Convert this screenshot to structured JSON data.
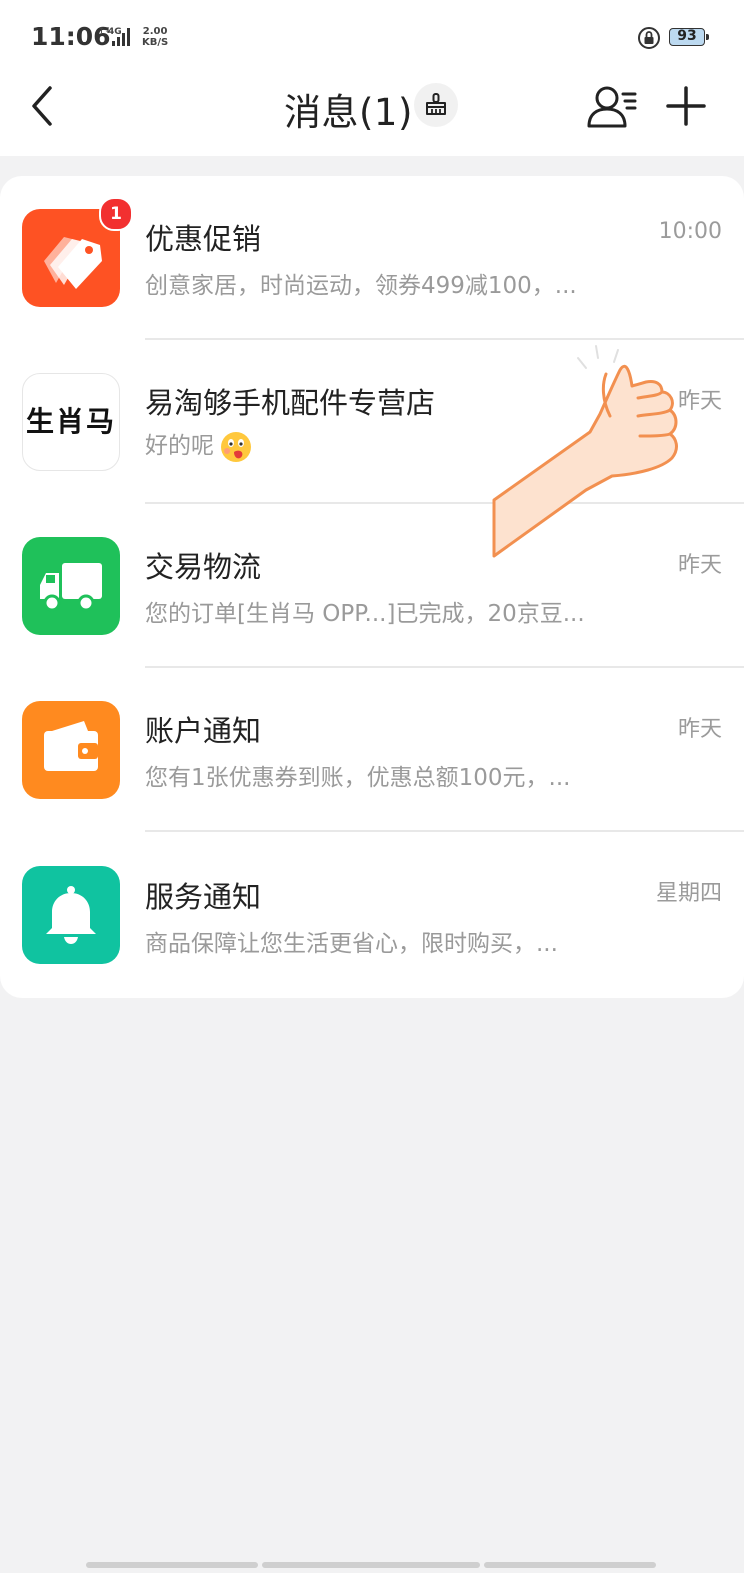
{
  "status_bar": {
    "time": "11:06",
    "network": "4G",
    "speed_value": "2.00",
    "speed_unit": "KB/S",
    "battery": "93"
  },
  "nav": {
    "title": "消息(1)"
  },
  "messages": [
    {
      "title": "优惠促销",
      "preview": "创意家居，时尚运动，领券499减100，...",
      "time": "10:00",
      "badge": "1",
      "icon": "price-tag-icon",
      "color": "#fe5223"
    },
    {
      "title": "易淘够手机配件专营店",
      "preview": "好的呢",
      "time": "昨天",
      "icon_text": "生肖马",
      "icon": "shop-logo"
    },
    {
      "title": "交易物流",
      "preview": "您的订单[生肖马 OPP...]已完成，20京豆...",
      "time": "昨天",
      "icon": "truck-icon",
      "color": "#1fc15a"
    },
    {
      "title": "账户通知",
      "preview": "您有1张优惠券到账，优惠总额100元，...",
      "time": "昨天",
      "icon": "wallet-icon",
      "color": "#ff8a1f"
    },
    {
      "title": "服务通知",
      "preview": "商品保障让您生活更省心，限时购买，...",
      "time": "星期四",
      "icon": "bell-icon",
      "color": "#10c3a0"
    }
  ]
}
